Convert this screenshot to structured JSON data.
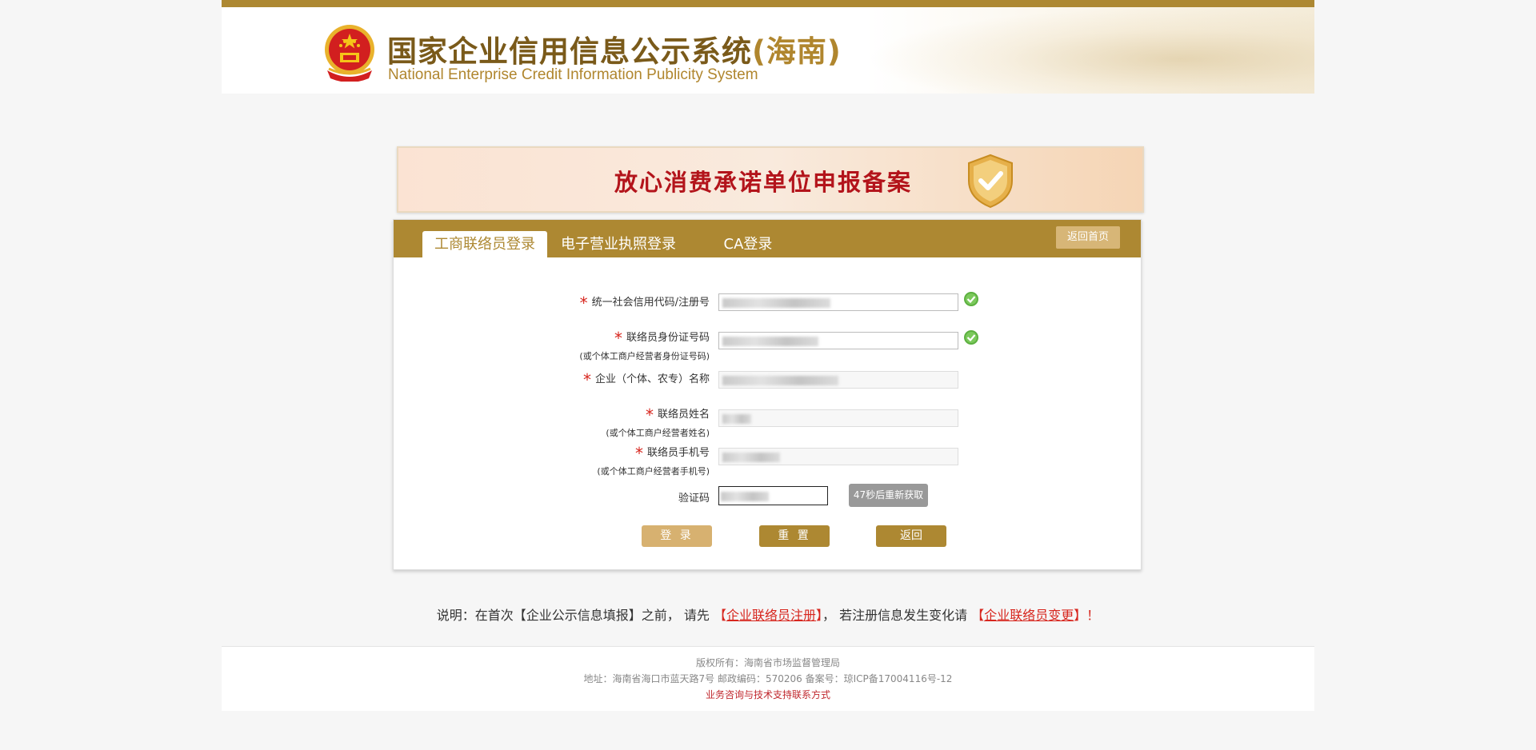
{
  "header": {
    "title_main": "国家企业信用信息公示系统",
    "title_region": "(海南)",
    "subtitle": "National Enterprise Credit Information Publicity System"
  },
  "banner": {
    "text": "放心消费承诺单位申报备案"
  },
  "tabs": [
    {
      "label": "工商联络员登录",
      "active": true
    },
    {
      "label": "电子营业执照登录",
      "active": false
    },
    {
      "label": "CA登录",
      "active": false
    }
  ],
  "home_button": "返回首页",
  "form": {
    "credit_code": {
      "label": "统一社会信用代码/注册号",
      "value": "",
      "verified": true
    },
    "id_number": {
      "label": "联络员身份证号码",
      "note": "(或个体工商户经营者身份证号码)",
      "value": "",
      "verified": true
    },
    "company_name": {
      "label": "企业（个体、农专）名称",
      "value": ""
    },
    "contact_name": {
      "label": "联络员姓名",
      "note": "(或个体工商户经营者姓名)",
      "value": ""
    },
    "mobile": {
      "label": "联络员手机号",
      "note": "(或个体工商户经营者手机号)",
      "value": ""
    },
    "captcha": {
      "label": "验证码",
      "value": ""
    },
    "sms_button": "47秒后重新获取",
    "buttons": {
      "login": "登 录",
      "reset": "重 置",
      "back": "返回"
    }
  },
  "notice": {
    "prefix": "说明：在首次【企业公示信息填报】之前，  请先",
    "register_link": "企业联络员注册",
    "middle": "， 若注册信息发生变化请",
    "change_link": "企业联络员变更",
    "suffix": "！"
  },
  "footer": {
    "copyright": "版权所有：海南省市场监督管理局",
    "address": "地址：海南省海口市蓝天路7号 邮政编码：570206 备案号：琼ICP备17004116号-12",
    "contact": "业务咨询与技术支持联系方式"
  },
  "colors": {
    "brand": "#ad8832",
    "brand_light": "#d7b677",
    "required": "#d7261e",
    "disabled": "#999999"
  },
  "icons": {
    "emblem": "national-emblem-icon",
    "shield": "shield-check-icon",
    "check": "green-check-icon"
  }
}
